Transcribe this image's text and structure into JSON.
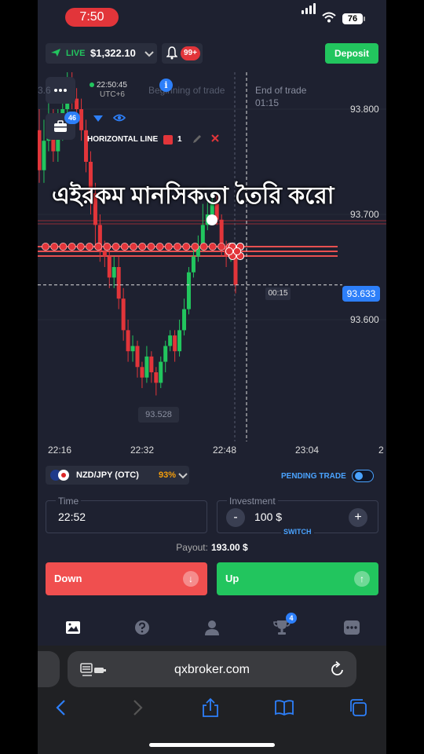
{
  "status_bar": {
    "time": "7:50",
    "battery": "76"
  },
  "header": {
    "account_mode": "LIVE",
    "balance": "$1,322.10",
    "notification_count": "99+",
    "deposit_label": "Deposit"
  },
  "chart": {
    "server_time": "22:50:45",
    "timezone": "UTC+6",
    "left_price_fragment": "3.6",
    "beginning_label": "Beginning of trade",
    "end_label": "End of trade",
    "end_time": "01:15",
    "portfolio_count": "46",
    "horizontal_line_label": "HORIZONTAL LINE",
    "horizontal_line_count": "1",
    "caption": "এইরকম মানসিকতা তৈরি করো",
    "price_labels": [
      "93.800",
      "93.700",
      "93.600"
    ],
    "current_price": "93.633",
    "countdown": "00:15",
    "low_price": "93.528",
    "x_ticks": [
      "22:16",
      "22:32",
      "22:48",
      "23:04",
      "2"
    ]
  },
  "chart_data": {
    "type": "candlestick",
    "x_ticks": [
      "22:16",
      "22:32",
      "22:48",
      "23:04"
    ],
    "y_ticks": [
      93.6,
      93.7,
      93.8
    ],
    "current_price": 93.633,
    "low_price": 93.528,
    "candles": [
      [
        93.78,
        93.742,
        93.8,
        93.73
      ],
      [
        93.742,
        93.77,
        93.79,
        93.73
      ],
      [
        93.77,
        93.79,
        93.81,
        93.76
      ],
      [
        93.79,
        93.76,
        93.8,
        93.75
      ],
      [
        93.76,
        93.78,
        93.8,
        93.75
      ],
      [
        93.78,
        93.8,
        93.82,
        93.77
      ],
      [
        93.8,
        93.82,
        93.84,
        93.79
      ],
      [
        93.82,
        93.81,
        93.84,
        93.8
      ],
      [
        93.81,
        93.8,
        93.82,
        93.79
      ],
      [
        93.8,
        93.78,
        93.81,
        93.77
      ],
      [
        93.78,
        93.75,
        93.79,
        93.74
      ],
      [
        93.75,
        93.72,
        93.76,
        93.7
      ],
      [
        93.72,
        93.69,
        93.73,
        93.67
      ],
      [
        93.69,
        93.665,
        93.7,
        93.655
      ],
      [
        93.665,
        93.66,
        93.675,
        93.65
      ],
      [
        93.66,
        93.64,
        93.67,
        93.63
      ],
      [
        93.64,
        93.65,
        93.66,
        93.63
      ],
      [
        93.65,
        93.62,
        93.66,
        93.61
      ],
      [
        93.62,
        93.59,
        93.63,
        93.58
      ],
      [
        93.59,
        93.57,
        93.6,
        93.56
      ],
      [
        93.57,
        93.575,
        93.585,
        93.56
      ],
      [
        93.575,
        93.555,
        93.58,
        93.545
      ],
      [
        93.555,
        93.545,
        93.56,
        93.535
      ],
      [
        93.545,
        93.565,
        93.575,
        93.54
      ],
      [
        93.565,
        93.55,
        93.57,
        93.54
      ],
      [
        93.55,
        93.54,
        93.555,
        93.528
      ],
      [
        93.54,
        93.56,
        93.565,
        93.535
      ],
      [
        93.56,
        93.575,
        93.58,
        93.55
      ],
      [
        93.575,
        93.585,
        93.59,
        93.57
      ],
      [
        93.585,
        93.57,
        93.59,
        93.56
      ],
      [
        93.57,
        93.59,
        93.6,
        93.565
      ],
      [
        93.59,
        93.61,
        93.62,
        93.585
      ],
      [
        93.61,
        93.645,
        93.65,
        93.605
      ],
      [
        93.645,
        93.66,
        93.67,
        93.64
      ],
      [
        93.66,
        93.67,
        93.68,
        93.655
      ],
      [
        93.67,
        93.69,
        93.71,
        93.665
      ],
      [
        93.69,
        93.7,
        93.715,
        93.685
      ],
      [
        93.7,
        93.71,
        93.72,
        93.69
      ],
      [
        93.71,
        93.695,
        93.72,
        93.69
      ],
      [
        93.695,
        93.67,
        93.7,
        93.66
      ],
      [
        93.67,
        93.66,
        93.675,
        93.65
      ],
      [
        93.66,
        93.665,
        93.67,
        93.655
      ],
      [
        93.665,
        93.633,
        93.67,
        93.625
      ]
    ]
  },
  "trade": {
    "asset": "NZD/JPY (OTC)",
    "payout_percent": "93%",
    "pending_label": "PENDING TRADE",
    "time_label": "Time",
    "time_value": "22:52",
    "investment_label": "Investment",
    "investment_value": "100 $",
    "switch_label": "SWITCH",
    "minus": "-",
    "plus": "+",
    "payout_label": "Payout:",
    "payout_value": "193.00 $",
    "down_label": "Down",
    "up_label": "Up"
  },
  "nav": {
    "trophy_badge": "4"
  },
  "browser": {
    "url": "qxbroker.com"
  },
  "colors": {
    "green": "#22c55e",
    "red": "#e2353a",
    "blue": "#2d7ff9",
    "bg": "#1e2130",
    "panel": "#2a2e3d"
  }
}
